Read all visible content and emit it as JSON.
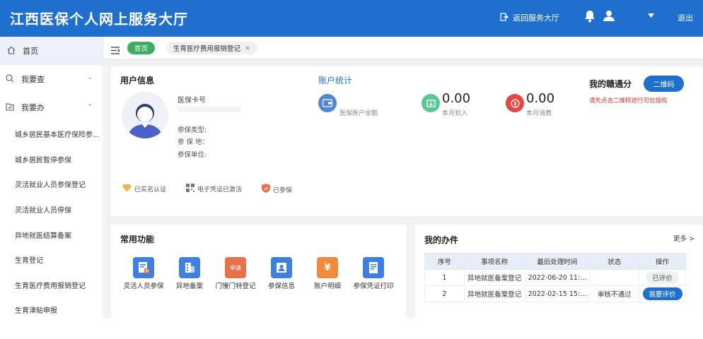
{
  "header": {
    "title": "江西医保个人网上服务大厅",
    "back_label": "返回服务大厅",
    "logout_label": "退出"
  },
  "sidebar": {
    "home": "首页",
    "query": "我要查",
    "handle": "我要办",
    "items": [
      "城乡居民基本医疗保险参...",
      "城乡居民暂停参保",
      "灵活就业人员参保登记",
      "灵活就业人员停保",
      "异地就医结算备案",
      "生育登记",
      "生育医疗费用报销登记",
      "生育津贴申报"
    ]
  },
  "tabs": {
    "home": "首页",
    "current": "生育医疗费用报销登记",
    "close": "×"
  },
  "user_info": {
    "title": "用户信息",
    "card_label": "医保卡号",
    "type_label": "参保类型:",
    "place_label": "参 保 地：",
    "unit_label": "参保单位:",
    "badges": [
      "已实名认证",
      "电子凭证已激活",
      "已参保"
    ]
  },
  "account": {
    "title": "账户统计",
    "balance_label": "医保账户余额",
    "in_value": "0.00",
    "in_label": "本月划入",
    "out_value": "0.00",
    "out_label": "本月消费"
  },
  "gantong": {
    "title": "我的赣通分",
    "qr_button": "二维码",
    "notice": "请先点击二维码进行可信授权"
  },
  "functions": {
    "title": "常用功能",
    "items": [
      "灵活人员参保",
      "异地备案",
      "门慢门特登记",
      "参保信息",
      "账户明细",
      "参保凭证打印"
    ],
    "icon_texts": [
      "",
      "",
      "申请",
      "",
      "¥",
      ""
    ]
  },
  "todo": {
    "title": "我的办件",
    "more": "更多 >",
    "headers": [
      "序号",
      "事项名称",
      "最后处理时间",
      "状态",
      "操作"
    ],
    "rows": [
      {
        "no": "1",
        "name": "异地就医备案登记",
        "time": "2022-06-20 11:...",
        "status": "",
        "action": "已评价"
      },
      {
        "no": "2",
        "name": "异地就医备案登记",
        "time": "2022-02-15 15:...",
        "status": "审核不通过",
        "action": "我要评价"
      }
    ]
  },
  "colors": {
    "header": "#1f6fcf",
    "home_tab": "#3cae63",
    "accent": "#1f6fcf",
    "warn": "#d0342c"
  }
}
